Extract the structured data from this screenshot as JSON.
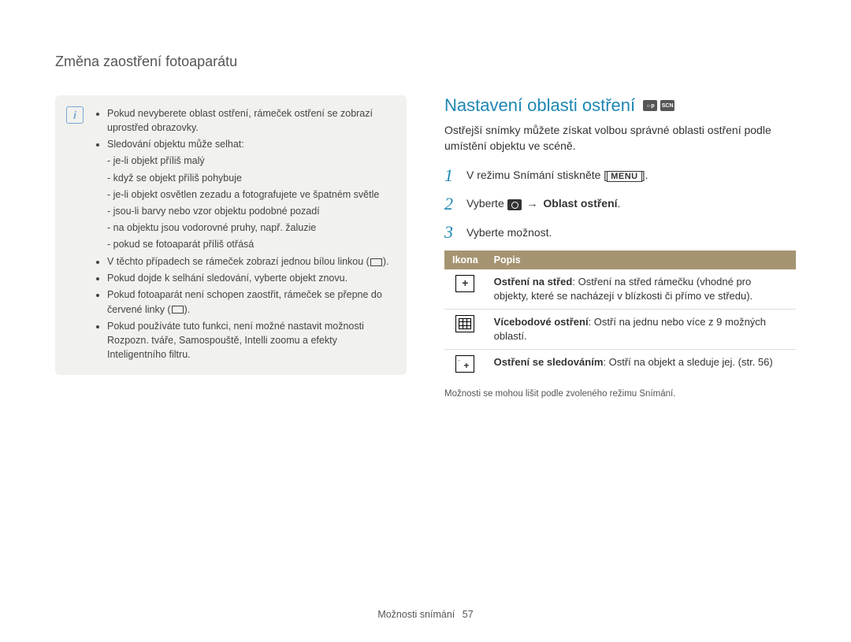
{
  "header": {
    "title": "Změna zaostření fotoaparátu"
  },
  "note": {
    "bullets": {
      "b1": "Pokud nevyberete oblast ostření, rámeček ostření se zobrazí uprostřed obrazovky.",
      "b2": "Sledování objektu může selhat:",
      "b2_subs": {
        "s1": "je-li objekt příliš malý",
        "s2": "když se objekt příliš pohybuje",
        "s3": "je-li objekt osvětlen zezadu a fotografujete ve špatném světle",
        "s4": "jsou-li barvy nebo vzor objektu podobné pozadí",
        "s5": "na objektu jsou vodorovné pruhy, např. žaluzie",
        "s6": "pokud se fotoaparát příliš otřásá"
      },
      "b3_pre": "V těchto případech se rámeček zobrazí jednou bílou linkou (",
      "b3_post": ").",
      "b4": "Pokud dojde k selhání sledování, vyberte objekt znovu.",
      "b5_pre": "Pokud fotoaparát není schopen zaostřit, rámeček se přepne do červené linky (",
      "b5_post": ").",
      "b6": "Pokud používáte tuto funkci, není možné nastavit možnosti Rozpozn. tváře, Samospouště, Intelli zoomu a efekty Inteligentního filtru."
    }
  },
  "right": {
    "section_title": "Nastavení oblasti ostření",
    "intro": "Ostřejší snímky můžete získat volbou správné oblasti ostření podle umístění objektu ve scéně.",
    "steps": {
      "s1_pre": "V režimu Snímání stiskněte [",
      "s1_menu": "MENU",
      "s1_post": "].",
      "s2_pre": "Vyberte ",
      "s2_arrow": "→",
      "s2_bold": "Oblast ostření",
      "s2_post": ".",
      "s3": "Vyberte možnost."
    },
    "table": {
      "h1": "Ikona",
      "h2": "Popis",
      "r1_bold": "Ostření na střed",
      "r1_rest": ": Ostření na střed rámečku (vhodné pro objekty, které se nacházejí v blízkosti či přímo ve středu).",
      "r2_bold": "Vícebodové ostření",
      "r2_rest": ": Ostří na jednu nebo více z 9 možných oblastí.",
      "r3_bold": "Ostření se sledováním",
      "r3_rest": ": Ostří na objekt a sleduje jej. (str. 56)"
    },
    "caption": "Možnosti se mohou lišit podle zvoleného režimu Snímání."
  },
  "footer": {
    "label": "Možnosti snímání",
    "page": "57"
  }
}
